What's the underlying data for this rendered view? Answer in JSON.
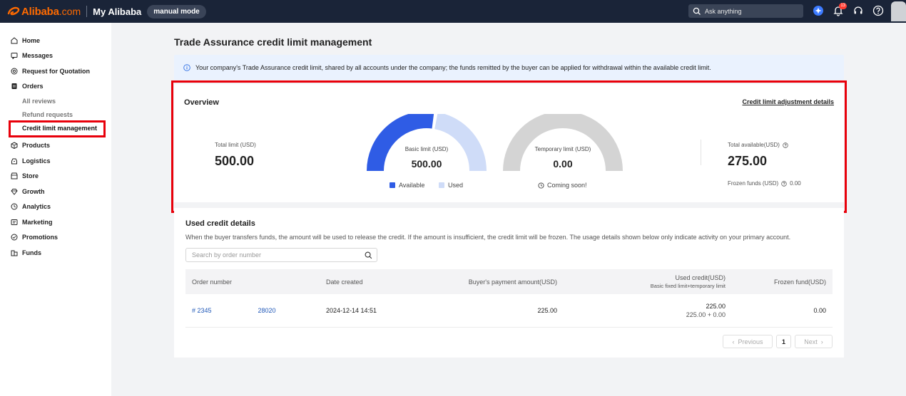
{
  "topbar": {
    "brand": "Alibaba",
    "brand_suffix": ".com",
    "my_alibaba": "My Alibaba",
    "mode": "manual mode",
    "search_placeholder": "Ask anything",
    "notification_count": "13"
  },
  "sidebar": {
    "items": [
      {
        "label": "Home",
        "icon": "home-icon"
      },
      {
        "label": "Messages",
        "icon": "message-icon"
      },
      {
        "label": "Request for Quotation",
        "icon": "rfq-icon"
      },
      {
        "label": "Orders",
        "icon": "orders-icon"
      },
      {
        "label": "Products",
        "icon": "box-icon"
      },
      {
        "label": "Logistics",
        "icon": "truck-icon"
      },
      {
        "label": "Store",
        "icon": "store-icon"
      },
      {
        "label": "Growth",
        "icon": "diamond-icon"
      },
      {
        "label": "Analytics",
        "icon": "clock-icon"
      },
      {
        "label": "Marketing",
        "icon": "marketing-icon"
      },
      {
        "label": "Promotions",
        "icon": "promotion-icon"
      },
      {
        "label": "Funds",
        "icon": "funds-icon"
      }
    ],
    "orders_sub": [
      "All reviews",
      "Refund requests",
      "Credit limit management"
    ]
  },
  "page": {
    "title": "Trade Assurance credit limit management",
    "info": "Your company's Trade Assurance credit limit, shared by all accounts under the company; the funds remitted by the buyer can be applied for withdrawal within the available credit limit."
  },
  "overview": {
    "title": "Overview",
    "adjust_link": "Credit limit adjustment details",
    "total_limit_label": "Total limit (USD)",
    "total_limit_value": "500.00",
    "basic_limit_label": "Basic limit (USD)",
    "basic_limit_value": "500.00",
    "basic_available_fraction": 0.55,
    "legend_available": "Available",
    "legend_used": "Used",
    "temporary_limit_label": "Temporary limit (USD)",
    "temporary_limit_value": "0.00",
    "coming_soon": "Coming soon!",
    "total_available_label": "Total available(USD)",
    "total_available_value": "275.00",
    "frozen_funds_label": "Frozen funds (USD)",
    "frozen_funds_value": "0.00",
    "colors": {
      "available": "#2f5ce5",
      "used": "#cfdcf8",
      "temporary": "#d4d4d4"
    }
  },
  "used_credit": {
    "title": "Used credit details",
    "description": "When the buyer transfers funds, the amount will be used to release the credit. If the amount is insufficient, the credit limit will be frozen. The usage details shown below only indicate activity on your primary account.",
    "search_placeholder": "Search by order number",
    "columns": {
      "order_number": "Order number",
      "date_created": "Date created",
      "payment_amount": "Buyer's payment amount(USD)",
      "used_credit": "Used credit(USD)",
      "used_credit_sub": "Basic fixed limit+temporary limit",
      "frozen_fund": "Frozen fund(USD)"
    },
    "rows": [
      {
        "order_prefix": "# 2345",
        "order_suffix": "28020",
        "date": "2024-12-14 14:51",
        "payment": "225.00",
        "used": "225.00",
        "used_breakdown": "225.00 + 0.00",
        "frozen": "0.00"
      }
    ],
    "pager": {
      "previous": "Previous",
      "page": "1",
      "next": "Next"
    }
  }
}
